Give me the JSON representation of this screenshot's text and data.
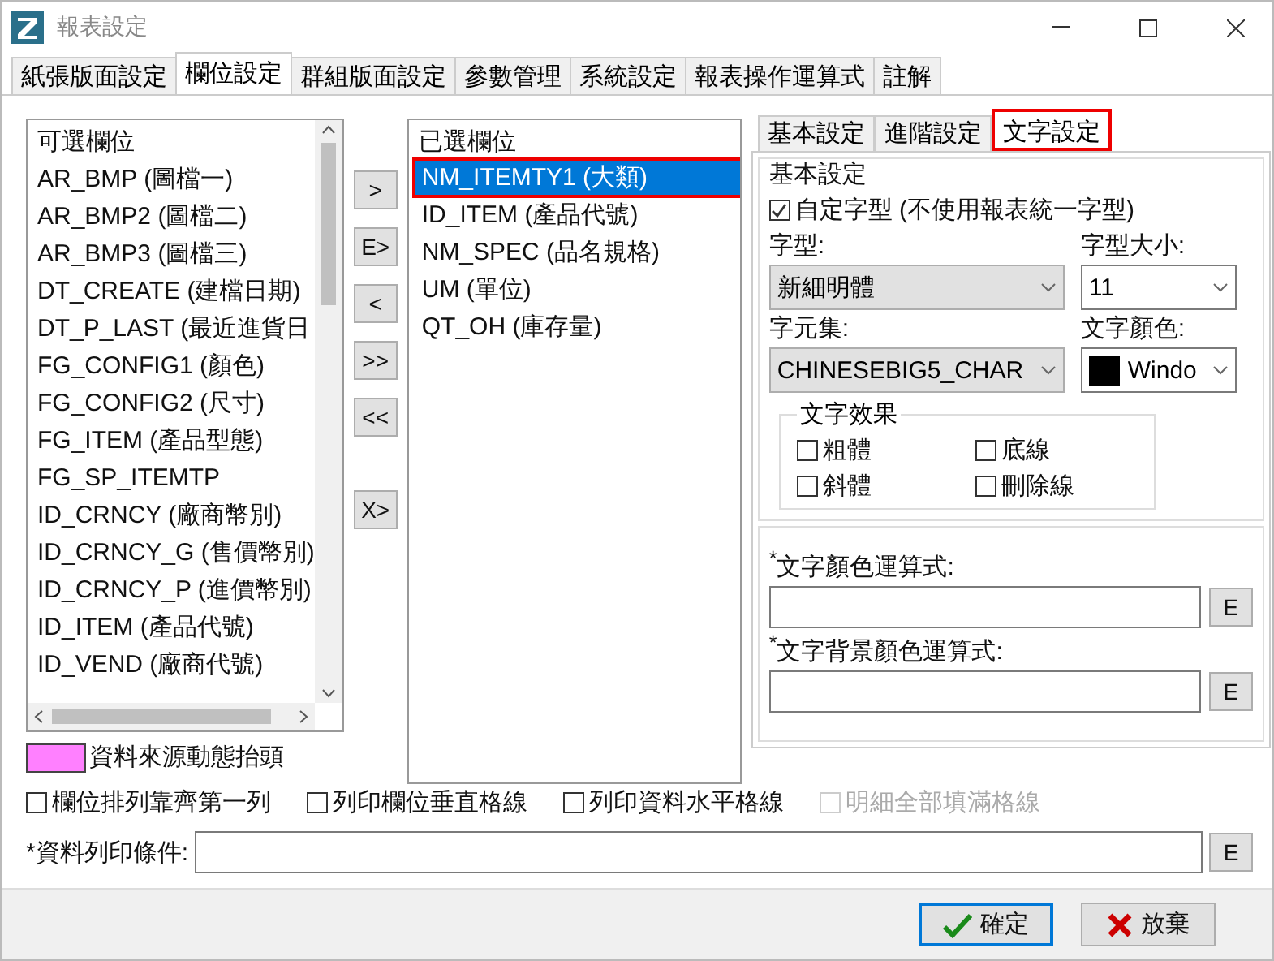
{
  "window": {
    "title": "報表設定"
  },
  "tabs": [
    {
      "label": "紙張版面設定",
      "selected": false
    },
    {
      "label": "欄位設定",
      "selected": true
    },
    {
      "label": "群組版面設定",
      "selected": false
    },
    {
      "label": "參數管理",
      "selected": false
    },
    {
      "label": "系統設定",
      "selected": false
    },
    {
      "label": "報表操作運算式",
      "selected": false
    },
    {
      "label": "註解",
      "selected": false
    }
  ],
  "available_fields": {
    "header": "可選欄位",
    "items": [
      "AR_BMP (圖檔一)",
      "AR_BMP2 (圖檔二)",
      "AR_BMP3 (圖檔三)",
      "DT_CREATE (建檔日期)",
      "DT_P_LAST (最近進貨日",
      "FG_CONFIG1 (顏色)",
      "FG_CONFIG2 (尺寸)",
      "FG_ITEM (產品型態)",
      "FG_SP_ITEMTP",
      "ID_CRNCY (廠商幣別)",
      "ID_CRNCY_G (售價幣別)",
      "ID_CRNCY_P (進價幣別)",
      "ID_ITEM (產品代號)",
      "ID_VEND (廠商代號)"
    ]
  },
  "transfer_buttons": [
    ">",
    "E>",
    "<",
    ">>",
    "<<",
    "X>"
  ],
  "selected_fields": {
    "header": "已選欄位",
    "items": [
      {
        "label": "NM_ITEMTY1 (大類)",
        "selected": true
      },
      {
        "label": "ID_ITEM (產品代號)",
        "selected": false
      },
      {
        "label": "NM_SPEC (品名規格)",
        "selected": false
      },
      {
        "label": "UM (單位)",
        "selected": false
      },
      {
        "label": "QT_OH (庫存量)",
        "selected": false
      }
    ]
  },
  "legend": {
    "color": "#ff80ff",
    "label": "資料來源動態抬頭"
  },
  "sub_tabs": [
    {
      "label": "基本設定",
      "selected": false
    },
    {
      "label": "進階設定",
      "selected": false
    },
    {
      "label": "文字設定",
      "selected": true
    }
  ],
  "basic": {
    "title": "基本設定",
    "custom_font": {
      "label": "自定字型 (不使用報表統一字型)",
      "checked": true
    },
    "font": {
      "label": "字型:",
      "value": "新細明體"
    },
    "font_size": {
      "label": "字型大小:",
      "value": "11"
    },
    "charset": {
      "label": "字元集:",
      "value": "CHINESEBIG5_CHAR"
    },
    "text_color": {
      "label": "文字顏色:",
      "value": "Windo",
      "color": "#000000"
    }
  },
  "effects": {
    "title": "文字效果",
    "options": [
      {
        "label": "粗體",
        "checked": false
      },
      {
        "label": "底線",
        "checked": false
      },
      {
        "label": "斜體",
        "checked": false
      },
      {
        "label": "刪除線",
        "checked": false
      }
    ]
  },
  "expressions": [
    {
      "label": "$^{*}$文字顏色運算式:",
      "button": "E"
    },
    {
      "label": "$^{*}$文字背景顏色運算式:",
      "button": "E"
    }
  ],
  "options": [
    {
      "label": "欄位排列靠齊第一列",
      "checked": false,
      "disabled": false
    },
    {
      "label": "列印欄位垂直格線",
      "checked": false,
      "disabled": false
    },
    {
      "label": "列印資料水平格線",
      "checked": false,
      "disabled": false
    },
    {
      "label": "明細全部填滿格線",
      "checked": false,
      "disabled": true
    }
  ],
  "condition": {
    "label": "*資料列印條件:",
    "button": "E"
  },
  "footer_buttons": [
    {
      "label": "確定",
      "kind": "ok"
    },
    {
      "label": "放棄",
      "kind": "cancel"
    }
  ]
}
